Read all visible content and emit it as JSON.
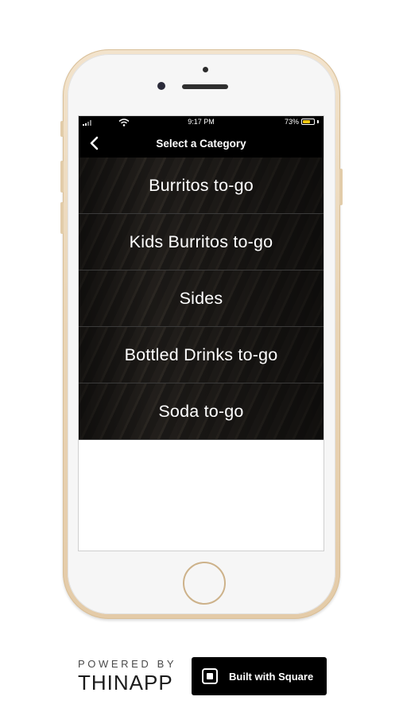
{
  "status_bar": {
    "time": "9:17 PM",
    "battery_percent": "73%",
    "battery_level": 0.73,
    "battery_color": "#f2c80f"
  },
  "nav": {
    "title": "Select a Category",
    "back_icon": "chevron-left-icon"
  },
  "categories": [
    {
      "label": "Burritos to-go"
    },
    {
      "label": "Kids Burritos to-go"
    },
    {
      "label": "Sides"
    },
    {
      "label": "Bottled Drinks to-go"
    },
    {
      "label": "Soda to-go"
    }
  ],
  "footer": {
    "powered_by": "POWERED BY",
    "thinapp_logo": "THINAPP",
    "square_badge_label": "Built with Square",
    "square_icon": "square-logo-icon"
  }
}
